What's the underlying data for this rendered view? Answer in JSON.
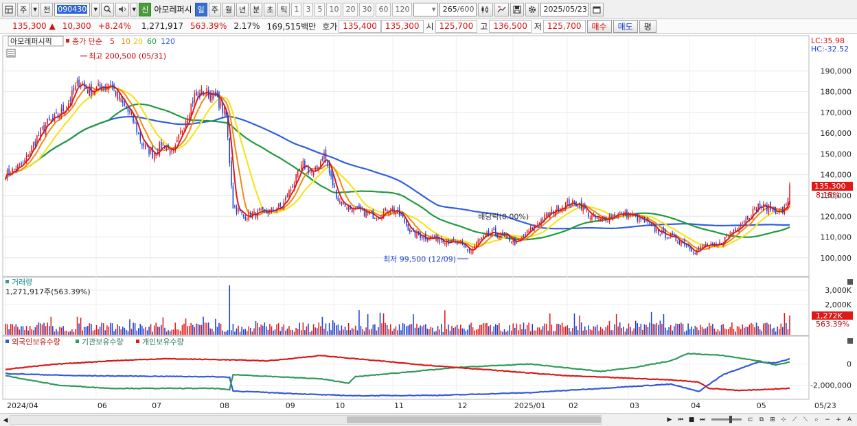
{
  "toolbar": {
    "period_label": "주",
    "prev_label": "전",
    "stock_code": "090430",
    "stock_name": "아모레퍼시",
    "credit_badge": "신",
    "intervals": [
      "일",
      "주",
      "월",
      "년",
      "분",
      "초",
      "틱"
    ],
    "active_interval": "일",
    "numbers": [
      "1",
      "3",
      "5",
      "10",
      "20",
      "30",
      "60",
      "120"
    ],
    "count_display": "265",
    "count_total": "/600",
    "date_value": "2025/05/23"
  },
  "quote": {
    "price": "135,300",
    "change_arrow": "▲",
    "change": "10,300",
    "change_pct": "+8.24%",
    "volume": "1,271,917",
    "volume_ratio": "563.39%",
    "turnover": "2.17%",
    "amount": "169,515백만",
    "bid_label": "호가",
    "bid": "135,400",
    "ask": "135,300",
    "open_label": "시",
    "open": "125,700",
    "high_label": "고",
    "high": "136,500",
    "low_label": "저",
    "low": "125,700",
    "buy_button": "매수",
    "sell_button": "매도",
    "eval_button": "평"
  },
  "colors": {
    "up": "#e01818",
    "down": "#1a3fd0",
    "ma5": "#e01818",
    "ma10": "#f08a10",
    "ma20": "#f5e51e",
    "ma60": "#1f9a3a",
    "ma120": "#2f5fe0",
    "foreign": "#3358e0",
    "institution": "#2f9a5a",
    "individual": "#d81a1a"
  },
  "icons": [
    "chart-layout-icon",
    "search-icon",
    "speaker-icon",
    "candle-icon",
    "drawing-icon",
    "save-icon",
    "gear-icon",
    "calendar-icon"
  ],
  "chart_data": [
    {
      "type": "candlestick",
      "panel": "price",
      "stock_label": "아모레퍼시픽",
      "legend": {
        "prefix": "종가 단순",
        "periods": [
          "5",
          "10",
          "20",
          "60",
          "120"
        ]
      },
      "max_annotation": "최고 200,500 (05/31)",
      "min_annotation": "최저 99,500 (12/09)",
      "dividend_annotation": "배당락(0.00%)",
      "lc_label": "LC:35.98",
      "hc_label": "HC:-32.52",
      "current_price_label": "135,300",
      "current_pct_label": "8.15%",
      "y_ticks": [
        100000,
        110000,
        120000,
        130000,
        140000,
        150000,
        160000,
        170000,
        180000,
        190000
      ],
      "y_tick_labels": [
        "100,000",
        "110,000",
        "120,000",
        "130,000",
        "140,000",
        "150,000",
        "160,000",
        "170,000",
        "180,000",
        "190,000"
      ],
      "ylim": [
        92000,
        205000
      ],
      "close_anchors": [
        [
          0,
          140000
        ],
        [
          10,
          145000
        ],
        [
          18,
          158000
        ],
        [
          24,
          165000
        ],
        [
          30,
          168000
        ],
        [
          36,
          175000
        ],
        [
          42,
          185000
        ],
        [
          48,
          180000
        ],
        [
          54,
          182000
        ],
        [
          60,
          184000
        ],
        [
          66,
          175000
        ],
        [
          72,
          168000
        ],
        [
          78,
          155000
        ],
        [
          84,
          150000
        ],
        [
          90,
          155000
        ],
        [
          96,
          150000
        ],
        [
          102,
          165000
        ],
        [
          108,
          178000
        ],
        [
          114,
          180000
        ],
        [
          120,
          178000
        ],
        [
          126,
          168000
        ],
        [
          130,
          125000
        ],
        [
          136,
          120000
        ],
        [
          142,
          121000
        ],
        [
          150,
          122000
        ],
        [
          158,
          125000
        ],
        [
          164,
          135000
        ],
        [
          170,
          145000
        ],
        [
          176,
          140000
        ],
        [
          182,
          150000
        ],
        [
          186,
          138000
        ],
        [
          190,
          128000
        ],
        [
          196,
          124000
        ],
        [
          204,
          122000
        ],
        [
          212,
          120000
        ],
        [
          220,
          124000
        ],
        [
          226,
          120000
        ],
        [
          232,
          112000
        ],
        [
          240,
          110000
        ],
        [
          250,
          109000
        ],
        [
          260,
          106000
        ],
        [
          266,
          103000
        ],
        [
          270,
          108000
        ],
        [
          278,
          112000
        ],
        [
          286,
          110000
        ],
        [
          292,
          107000
        ],
        [
          298,
          112000
        ],
        [
          304,
          117000
        ],
        [
          312,
          122000
        ],
        [
          320,
          126000
        ],
        [
          328,
          126000
        ],
        [
          334,
          120000
        ],
        [
          340,
          118000
        ],
        [
          348,
          121000
        ],
        [
          356,
          121000
        ],
        [
          364,
          118000
        ],
        [
          372,
          113000
        ],
        [
          380,
          110000
        ],
        [
          388,
          107000
        ],
        [
          394,
          103000
        ],
        [
          400,
          106000
        ],
        [
          406,
          105000
        ],
        [
          414,
          112000
        ],
        [
          422,
          118000
        ],
        [
          430,
          125000
        ],
        [
          436,
          124000
        ],
        [
          442,
          122000
        ],
        [
          446,
          124000
        ],
        [
          448,
          135300
        ]
      ],
      "volume_panel": {
        "title": "거래량",
        "volume_label": "1,271,917주(563.39%)",
        "y_tick_labels": [
          "3,000K",
          "2,000K"
        ],
        "current_label": "1,272K",
        "current_pct": "563.39%"
      }
    },
    {
      "type": "line",
      "panel": "holdings",
      "series": [
        {
          "name": "외국인보유수량",
          "color": "#3358e0",
          "anchors": [
            [
              0,
              -900000
            ],
            [
              40,
              -1100000
            ],
            [
              120,
              -1200000
            ],
            [
              128,
              -1250000
            ],
            [
              130,
              -2550000
            ],
            [
              180,
              -2900000
            ],
            [
              200,
              -3000000
            ],
            [
              250,
              -2950000
            ],
            [
              300,
              -2700000
            ],
            [
              350,
              -2200000
            ],
            [
              380,
              -1900000
            ],
            [
              396,
              -2600000
            ],
            [
              410,
              -1000000
            ],
            [
              430,
              200000
            ],
            [
              440,
              100000
            ],
            [
              448,
              500000
            ]
          ]
        },
        {
          "name": "기관보유수량",
          "color": "#2f9a5a",
          "anchors": [
            [
              0,
              -1100000
            ],
            [
              30,
              -2000000
            ],
            [
              60,
              -2300000
            ],
            [
              120,
              -2300000
            ],
            [
              128,
              -2450000
            ],
            [
              130,
              -1000000
            ],
            [
              180,
              -1400000
            ],
            [
              196,
              -1800000
            ],
            [
              200,
              -1200000
            ],
            [
              260,
              -300000
            ],
            [
              300,
              0
            ],
            [
              340,
              -700000
            ],
            [
              360,
              -300000
            ],
            [
              380,
              300000
            ],
            [
              390,
              1000000
            ],
            [
              410,
              800000
            ],
            [
              430,
              300000
            ],
            [
              440,
              -100000
            ],
            [
              448,
              200000
            ]
          ]
        },
        {
          "name": "개인보유수량",
          "color": "#d81a1a",
          "anchors": [
            [
              0,
              -500000
            ],
            [
              30,
              0
            ],
            [
              60,
              300000
            ],
            [
              90,
              500000
            ],
            [
              128,
              400000
            ],
            [
              150,
              300000
            ],
            [
              180,
              800000
            ],
            [
              200,
              500000
            ],
            [
              240,
              -100000
            ],
            [
              280,
              -600000
            ],
            [
              320,
              -1100000
            ],
            [
              350,
              -1300000
            ],
            [
              380,
              -1500000
            ],
            [
              396,
              -1700000
            ],
            [
              402,
              -2300000
            ],
            [
              420,
              -2500000
            ],
            [
              448,
              -2300000
            ]
          ]
        }
      ],
      "y_tick_labels": [
        "0",
        "-2,000,000"
      ],
      "ylim": [
        -3200000,
        1600000
      ]
    }
  ],
  "x_axis": {
    "labels": [
      {
        "i": 0,
        "text": "2024/04"
      },
      {
        "i": 40,
        "text": "06"
      },
      {
        "i": 64,
        "text": "07"
      },
      {
        "i": 94,
        "text": "08"
      },
      {
        "i": 123,
        "text": "09"
      },
      {
        "i": 145,
        "text": "10"
      },
      {
        "i": 171,
        "text": "11"
      },
      {
        "i": 199,
        "text": "12"
      },
      {
        "i": 224,
        "text": "2025/01"
      },
      {
        "i": 248,
        "text": "02"
      },
      {
        "i": 275,
        "text": "03"
      },
      {
        "i": 302,
        "text": "04"
      },
      {
        "i": 331,
        "text": "05"
      }
    ],
    "end_label": "05/23"
  }
}
